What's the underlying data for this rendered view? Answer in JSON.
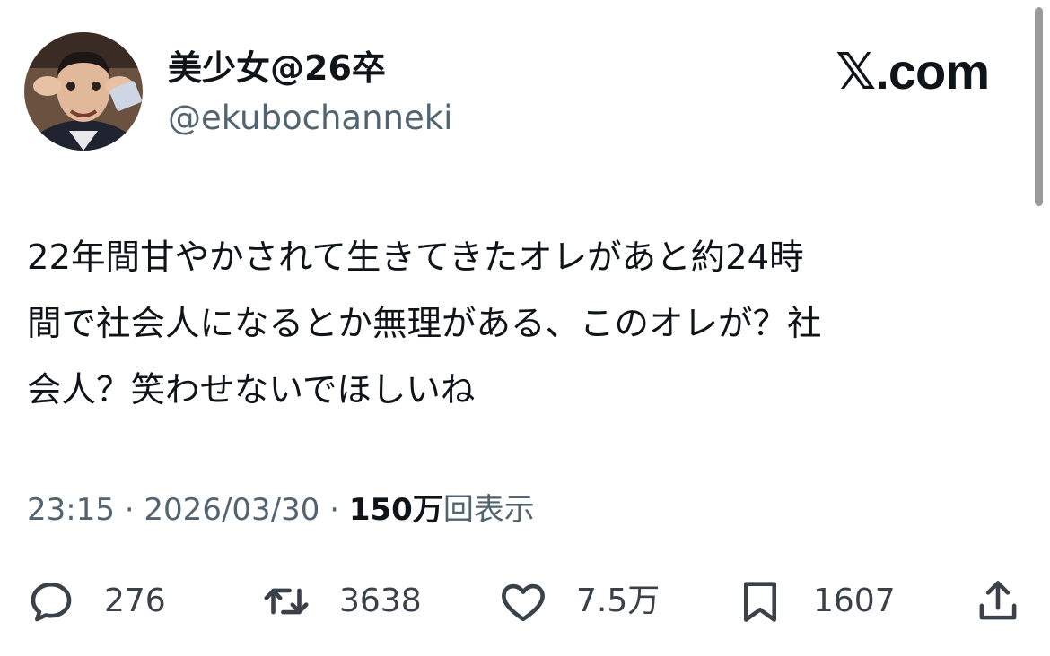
{
  "author": {
    "display_name": "美少女@26卒",
    "handle": "@ekubochanneki",
    "avatar_icon": "avatar-photo"
  },
  "brand": {
    "label": "𝕏.com"
  },
  "tweet": {
    "text": "22年間甘やかされて生きてきたオレがあと約24時\n間で社会人になるとか無理がある、このオレが？社\n会人？笑わせないでほしいね"
  },
  "meta": {
    "time": "23:15",
    "separator": " · ",
    "date": "2026/03/30",
    "views_count": "150万",
    "views_label": "回表示"
  },
  "actions": {
    "reply": {
      "icon": "reply-icon",
      "count": "276"
    },
    "retweet": {
      "icon": "retweet-icon",
      "count": "3638"
    },
    "like": {
      "icon": "heart-icon",
      "count": "7.5万"
    },
    "bookmark": {
      "icon": "bookmark-icon",
      "count": "1607"
    },
    "share": {
      "icon": "share-icon"
    }
  },
  "colors": {
    "text_primary": "#0f1419",
    "text_secondary": "#536471",
    "icon": "#3b4148",
    "background": "#ffffff"
  }
}
